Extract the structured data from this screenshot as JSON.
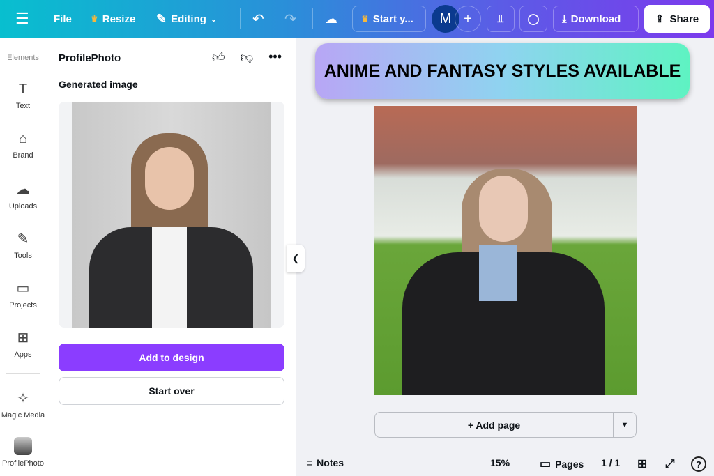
{
  "topbar": {
    "file": "File",
    "resize": "Resize",
    "editing": "Editing",
    "start": "Start y...",
    "avatar": "M",
    "download": "Download",
    "share": "Share"
  },
  "rail": {
    "items": [
      {
        "label": "Elements",
        "icon": "elements-icon"
      },
      {
        "label": "Text",
        "icon": "T"
      },
      {
        "label": "Brand",
        "icon": "⌂"
      },
      {
        "label": "Uploads",
        "icon": "☁"
      },
      {
        "label": "Tools",
        "icon": "✎"
      },
      {
        "label": "Projects",
        "icon": "▭"
      },
      {
        "label": "Apps",
        "icon": "⊞"
      },
      {
        "label": "Magic Media",
        "icon": "✧"
      },
      {
        "label": "ProfilePhoto",
        "icon": "▣"
      }
    ]
  },
  "panel": {
    "title": "ProfilePhoto",
    "subtitle": "Generated image",
    "add": "Add to design",
    "startover": "Start over"
  },
  "canvas": {
    "banner": "ANIME AND FANTASY STYLES AVAILABLE",
    "addpage": "+ Add page"
  },
  "bottom": {
    "notes": "Notes",
    "zoom": "15%",
    "pages": "Pages",
    "pagecount": "1 / 1"
  }
}
